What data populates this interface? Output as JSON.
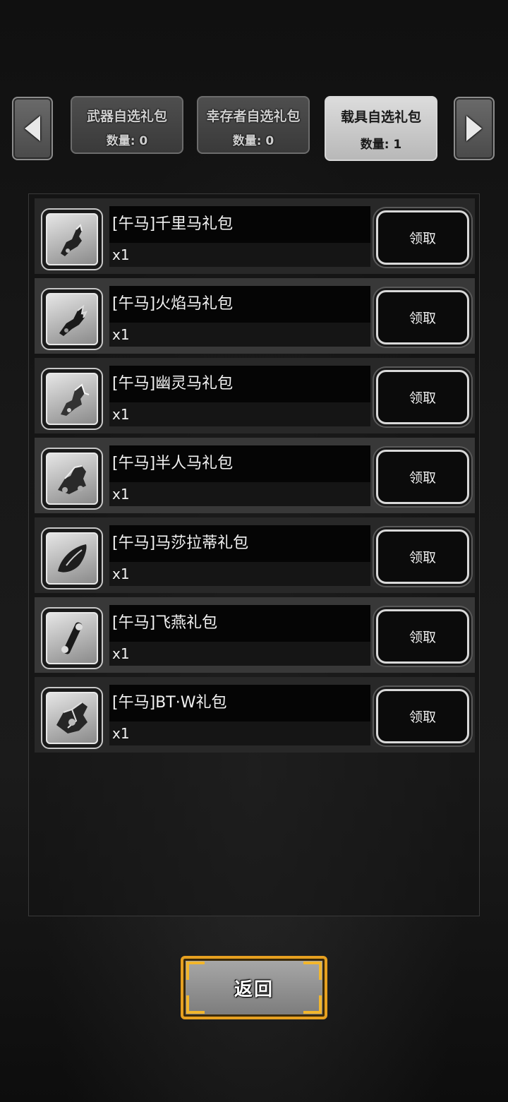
{
  "tabs": [
    {
      "title": "武器自选礼包",
      "count": "数量: 0",
      "active": false
    },
    {
      "title": "幸存者自选礼包",
      "count": "数量: 0",
      "active": false
    },
    {
      "title": "载具自选礼包",
      "count": "数量: 1",
      "active": true
    }
  ],
  "nav": {
    "prev_icon": "chevron-left-icon",
    "next_icon": "chevron-right-icon"
  },
  "items": [
    {
      "name": "[午马]千里马礼包",
      "qty": "x1",
      "button": "领取",
      "icon": "horse-vehicle-icon"
    },
    {
      "name": "[午马]火焰马礼包",
      "qty": "x1",
      "button": "领取",
      "icon": "fire-horse-vehicle-icon"
    },
    {
      "name": "[午马]幽灵马礼包",
      "qty": "x1",
      "button": "领取",
      "icon": "ghost-horse-vehicle-icon"
    },
    {
      "name": "[午马]半人马礼包",
      "qty": "x1",
      "button": "领取",
      "icon": "centaur-vehicle-icon"
    },
    {
      "name": "[午马]马莎拉蒂礼包",
      "qty": "x1",
      "button": "领取",
      "icon": "car-vehicle-icon"
    },
    {
      "name": "[午马]飞燕礼包",
      "qty": "x1",
      "button": "领取",
      "icon": "bike-vehicle-icon"
    },
    {
      "name": "[午马]BT·W礼包",
      "qty": "x1",
      "button": "领取",
      "icon": "mech-vehicle-icon"
    }
  ],
  "back_button": {
    "label": "返回"
  },
  "colors": {
    "accent_gold": "#e6a020",
    "active_tab": "#dcdcdc",
    "inactive_tab": "#4e4e4e"
  }
}
